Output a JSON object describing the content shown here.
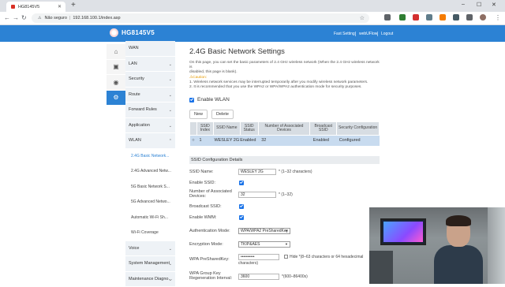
{
  "browser": {
    "tab_title": "HG8145V5",
    "new_tab": "+",
    "close": "✕",
    "not_secure": "Não seguro",
    "url": "192.168.100.1/index.asp",
    "separator": "|",
    "window_controls": [
      "–",
      "☐",
      "✕"
    ]
  },
  "header": {
    "brand": "HG8145V5",
    "links": [
      "Fast Setting",
      "webUFlow",
      "Logout"
    ]
  },
  "icons": [
    "wan-icon",
    "lan-icon",
    "security-icon",
    "route-icon",
    "forward-rules-icon",
    "application-icon"
  ],
  "sidebar": {
    "items": [
      {
        "label": "WAN",
        "chevron": false
      },
      {
        "label": "LAN",
        "chevron": true
      },
      {
        "label": "Security",
        "chevron": true
      },
      {
        "label": "Route",
        "chevron": true
      },
      {
        "label": "Forward Rules",
        "chevron": true
      },
      {
        "label": "Application",
        "chevron": true
      },
      {
        "label": "WLAN",
        "chevron": true
      }
    ],
    "subitems": [
      "2.4G Basic Network...",
      "2.4G Advanced Netw...",
      "5G Basic Network S...",
      "5G Advanced Netwo...",
      "Automatic Wi-Fi Sh...",
      "Wi-Fi Coverage"
    ],
    "active_sub": 0,
    "bottom_items": [
      "Voice",
      "System Management",
      "Maintenance Diagno..."
    ]
  },
  "content": {
    "title": "2.4G Basic Network Settings",
    "desc1": "On this page, you can set the basic parameters of 2.4 GHz wireless network (When the 2.4 GHz wireless network is",
    "desc2": "disabled, this page is blank).",
    "caution": "⚠Caution:",
    "desc3": "1. Wireless network services may be interrupted temporarily after you modify wireless network parameters.",
    "desc4": "2. It is recommended that you use the WPA2 or WPA/WPA2 authentication mode for security purposes.",
    "enable_wlan": "Enable WLAN",
    "new_btn": "New",
    "delete_btn": "Delete",
    "table": {
      "headers": [
        "SSID Index",
        "SSID Name",
        "SSID Status",
        "Number of Associated Devices",
        "Broadcast SSID",
        "Security Configuration"
      ],
      "rows": [
        [
          "1",
          "WESLEY 2G",
          "Enabled",
          "32",
          "Enabled",
          "Configured"
        ]
      ]
    },
    "section_title": "SSID Configuration Details",
    "fields": {
      "ssid_name_label": "SSID Name:",
      "ssid_name_value": "WESLEY 2G",
      "ssid_name_note": "* (1–32 characters)",
      "enable_ssid_label": "Enable SSID:",
      "num_devices_label": "Number of Associated Devices:",
      "num_devices_value": "32",
      "num_devices_note": "* (1–32)",
      "broadcast_label": "Broadcast SSID:",
      "wmm_label": "Enable WMM:",
      "auth_label": "Authentication Mode:",
      "auth_value": "WPA/WPA2 PreSharedKey",
      "enc_label": "Encryption Mode:",
      "enc_value": "TKIP&AES",
      "psk_label": "WPA PreSharedKey:",
      "psk_value": "••••••••••",
      "psk_hide": "Hide *(8–63 characters or 64 hexadecimal",
      "psk_hide2": "characters)",
      "regen_label": "WPA Group Key Regeneration Interval:",
      "regen_value": "3600",
      "regen_note": "*(600–86400s)"
    }
  }
}
